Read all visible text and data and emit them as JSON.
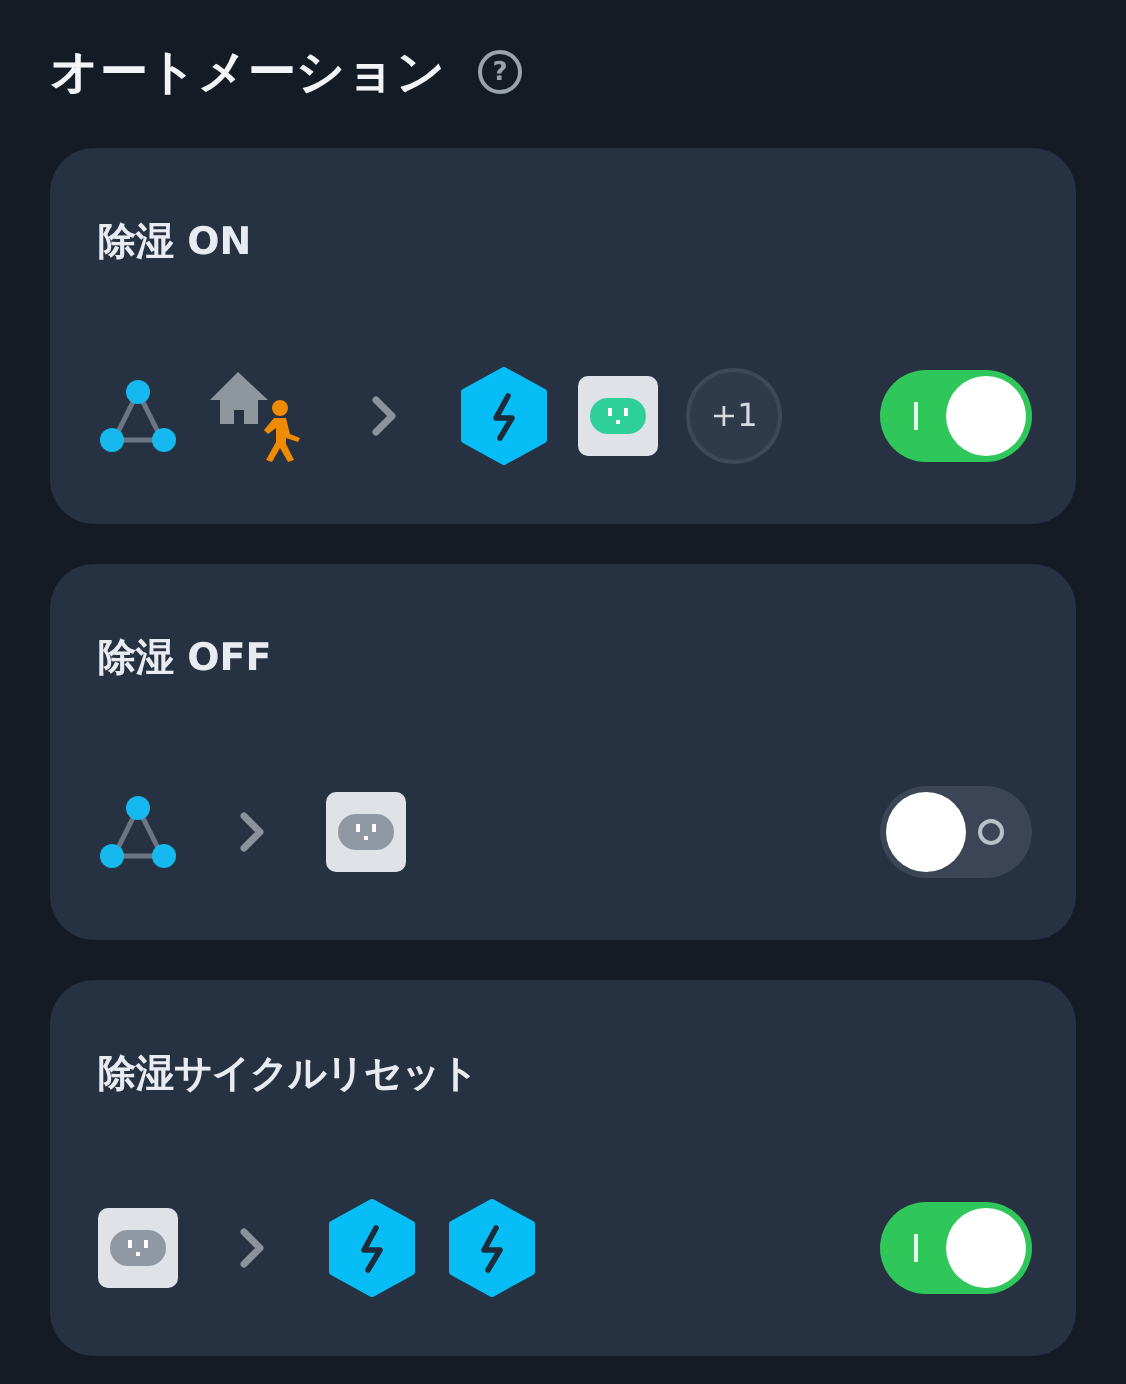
{
  "header": {
    "title": "オートメーション",
    "help": "?"
  },
  "automations": [
    {
      "name": "除湿 ON",
      "enabled": true,
      "triggers": [
        {
          "kind": "scene"
        },
        {
          "kind": "home-away"
        }
      ],
      "actions": [
        {
          "kind": "hub"
        },
        {
          "kind": "plug",
          "on": true
        },
        {
          "kind": "more",
          "text": "+1"
        }
      ]
    },
    {
      "name": "除湿 OFF",
      "enabled": false,
      "triggers": [
        {
          "kind": "scene"
        }
      ],
      "actions": [
        {
          "kind": "plug",
          "on": false
        }
      ]
    },
    {
      "name": "除湿サイクルリセット",
      "enabled": true,
      "triggers": [
        {
          "kind": "plug",
          "on": false
        }
      ],
      "actions": [
        {
          "kind": "hub"
        },
        {
          "kind": "hub"
        }
      ]
    }
  ]
}
